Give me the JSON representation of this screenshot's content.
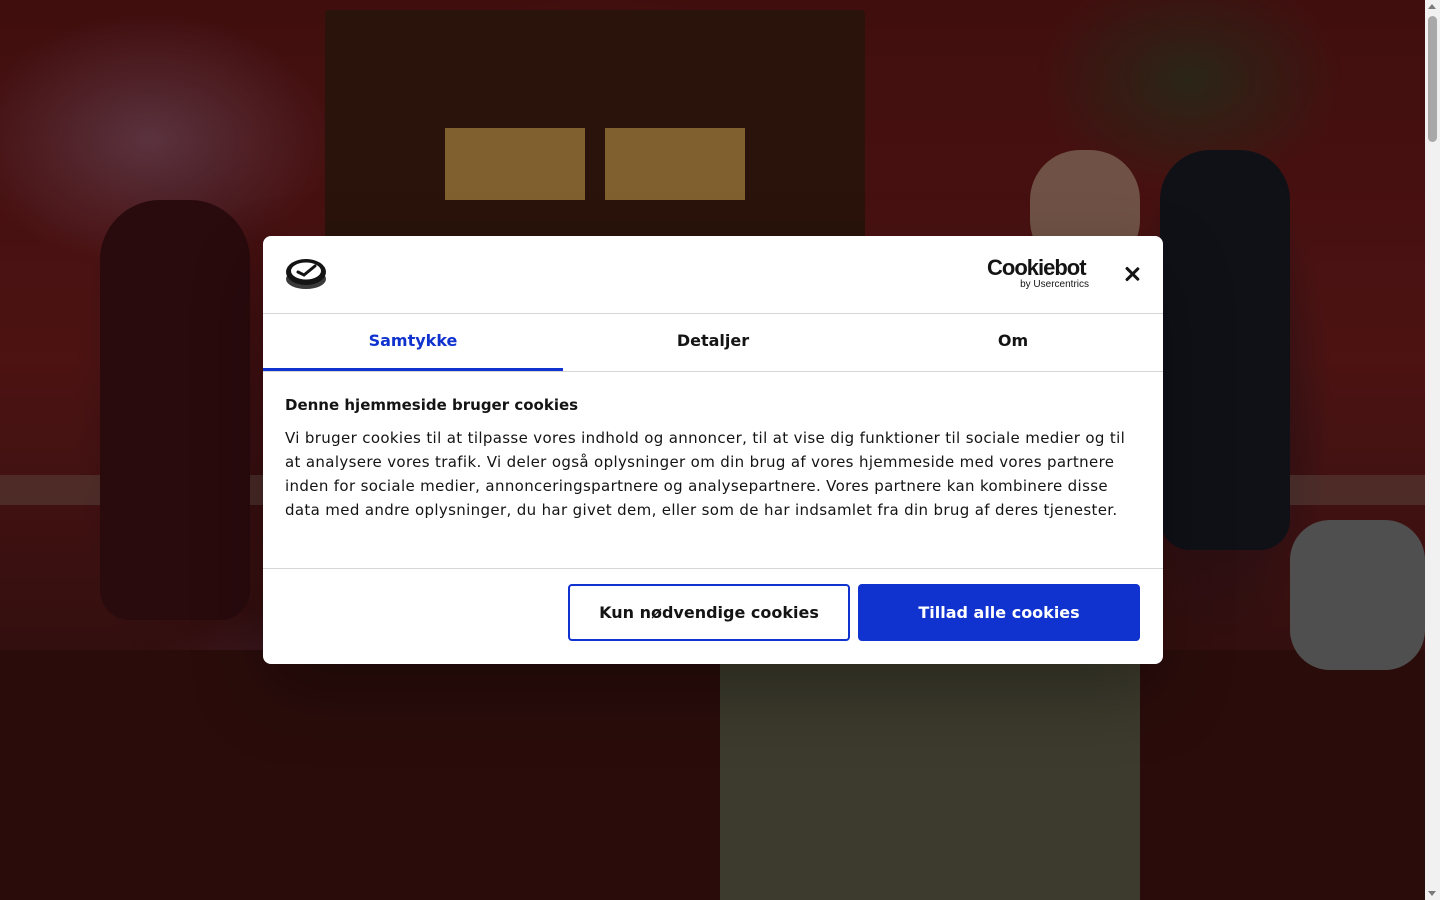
{
  "dialog": {
    "logo_icon": "site-logo-icon",
    "brand": {
      "name": "Cookiebot",
      "sub": "by Usercentrics"
    },
    "close_icon": "close-icon",
    "tabs": [
      {
        "label": "Samtykke",
        "active": true
      },
      {
        "label": "Detaljer",
        "active": false
      },
      {
        "label": "Om",
        "active": false
      }
    ],
    "heading": "Denne hjemmeside bruger cookies",
    "text": "Vi bruger cookies til at tilpasse vores indhold og annoncer, til at vise dig funktioner til sociale medier og til at analysere vores trafik. Vi deler også oplysninger om din brug af vores hjemmeside med vores partnere inden for sociale medier, annonceringspartnere og analysepartnere. Vores partnere kan kombinere disse data med andre oplysninger, du har givet dem, eller som de har indsamlet fra din brug af deres tjenester.",
    "buttons": {
      "necessary": "Kun nødvendige cookies",
      "allow_all": "Tillad alle cookies"
    }
  },
  "colors": {
    "accent": "#1032cf",
    "text": "#141414"
  }
}
